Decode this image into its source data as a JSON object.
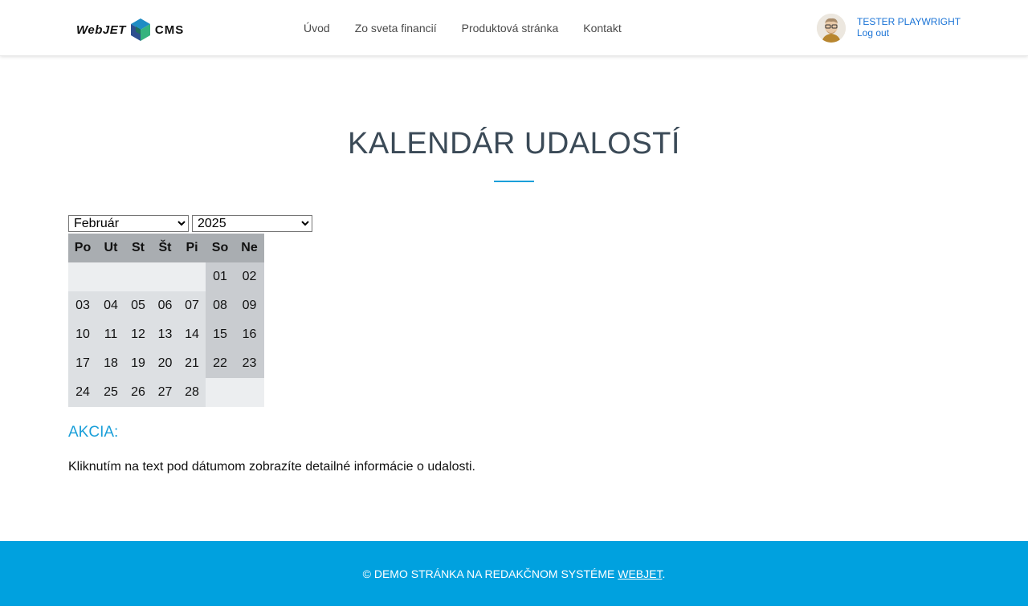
{
  "header": {
    "logo_left": "WebJET",
    "logo_right": "CMS",
    "nav": [
      {
        "label": "Úvod"
      },
      {
        "label": "Zo sveta financií"
      },
      {
        "label": "Produktová stránka"
      },
      {
        "label": "Kontakt"
      }
    ],
    "user_name": "TESTER PLAYWRIGHT",
    "logout_label": "Log out"
  },
  "main": {
    "title": "KALENDÁR UDALOSTÍ",
    "month_selected": "Február",
    "year_selected": "2025",
    "weekdays": [
      "Po",
      "Ut",
      "St",
      "Št",
      "Pi",
      "So",
      "Ne"
    ],
    "weeks": [
      [
        "",
        "",
        "",
        "",
        "",
        "01",
        "02"
      ],
      [
        "03",
        "04",
        "05",
        "06",
        "07",
        "08",
        "09"
      ],
      [
        "10",
        "11",
        "12",
        "13",
        "14",
        "15",
        "16"
      ],
      [
        "17",
        "18",
        "19",
        "20",
        "21",
        "22",
        "23"
      ],
      [
        "24",
        "25",
        "26",
        "27",
        "28",
        "",
        ""
      ]
    ],
    "section_title": "AKCIA:",
    "info_text": "Kliknutím na text pod dátumom zobrazíte detailné informácie o udalosti."
  },
  "footer": {
    "text": "© DEMO STRÁNKA NA REDAKČNOM SYSTÉME ",
    "link": "WEBJET",
    "suffix": "."
  },
  "colors": {
    "accent": "#00a1df",
    "title": "#3b4a57",
    "link": "#1a73d6"
  }
}
